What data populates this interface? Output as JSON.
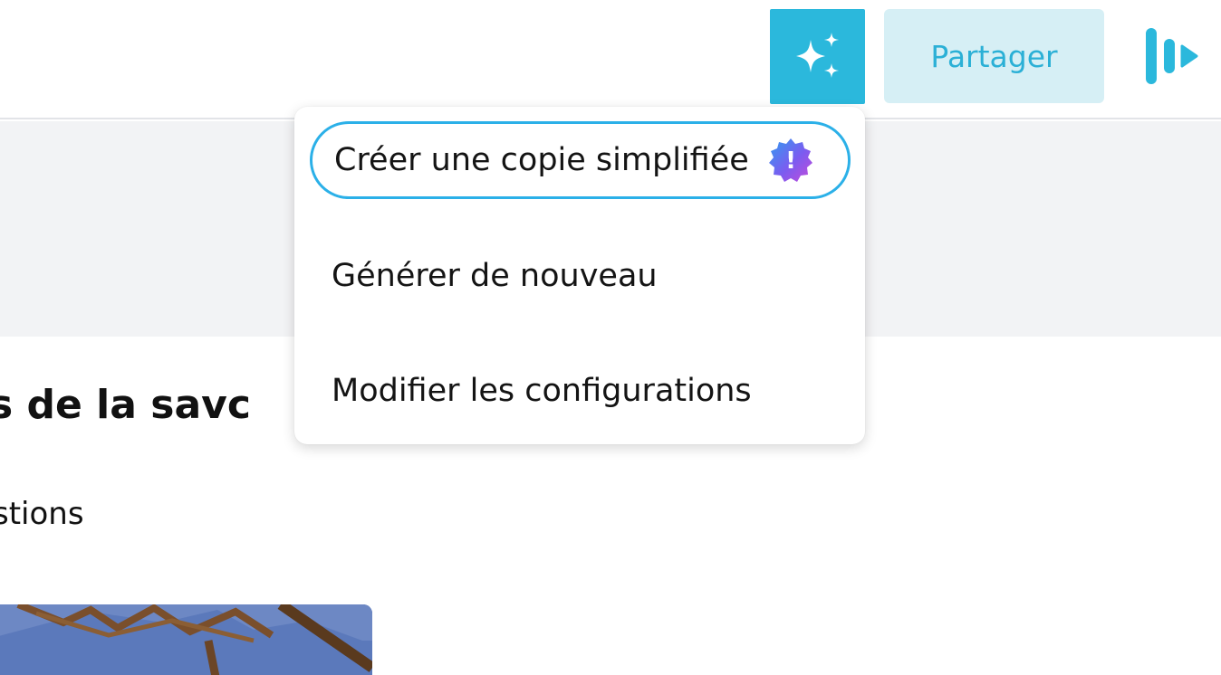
{
  "header": {
    "ai_icon": "sparkles-icon",
    "share_label": "Partager",
    "present_icon": "present-play-icon"
  },
  "menu": {
    "items": [
      {
        "label": "Créer une copie simplifiée",
        "badge_icon": "new-badge-icon",
        "badge_text": "!",
        "focused": true
      },
      {
        "label": "Générer de nouveau"
      },
      {
        "label": "Modifier les configurations"
      }
    ]
  },
  "content": {
    "title": "s de la savc",
    "subtitle": "stions"
  },
  "colors": {
    "accent": "#2bb8dc",
    "share_bg": "#d6eff5",
    "share_text": "#2bb0d6",
    "focus_ring": "#2bb0e8",
    "band": "#f2f3f5"
  }
}
